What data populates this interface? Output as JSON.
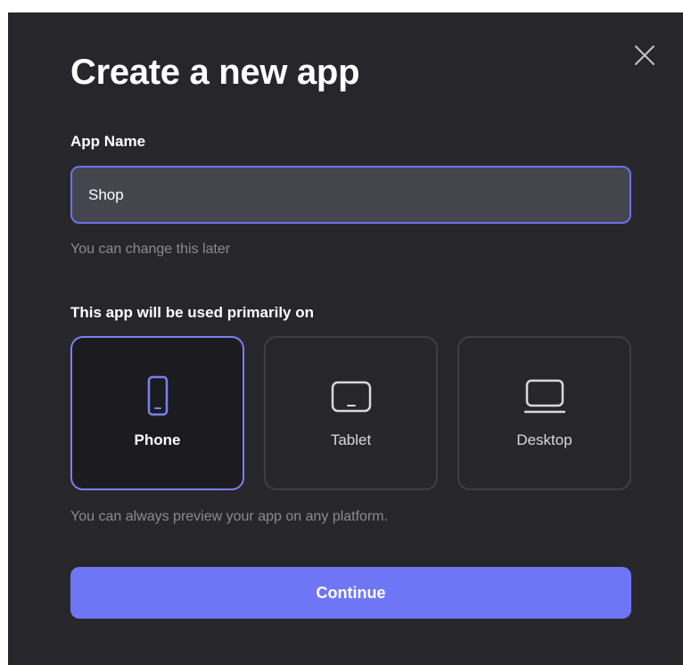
{
  "dialog": {
    "title": "Create a new app",
    "close_icon": "close-icon"
  },
  "app_name": {
    "label": "App Name",
    "value": "Shop",
    "hint": "You can change this later"
  },
  "platform": {
    "label": "This app will be used primarily on",
    "options": [
      {
        "label": "Phone",
        "icon": "phone-icon",
        "selected": true
      },
      {
        "label": "Tablet",
        "icon": "tablet-icon",
        "selected": false
      },
      {
        "label": "Desktop",
        "icon": "desktop-icon",
        "selected": false
      }
    ],
    "hint": "You can always preview your app on any platform."
  },
  "continue_label": "Continue",
  "colors": {
    "background": "#27272b",
    "accent": "#6f76f6",
    "selected_border": "#7b80f0",
    "input_bg": "#45454e",
    "hint_text": "#8a8a90"
  }
}
